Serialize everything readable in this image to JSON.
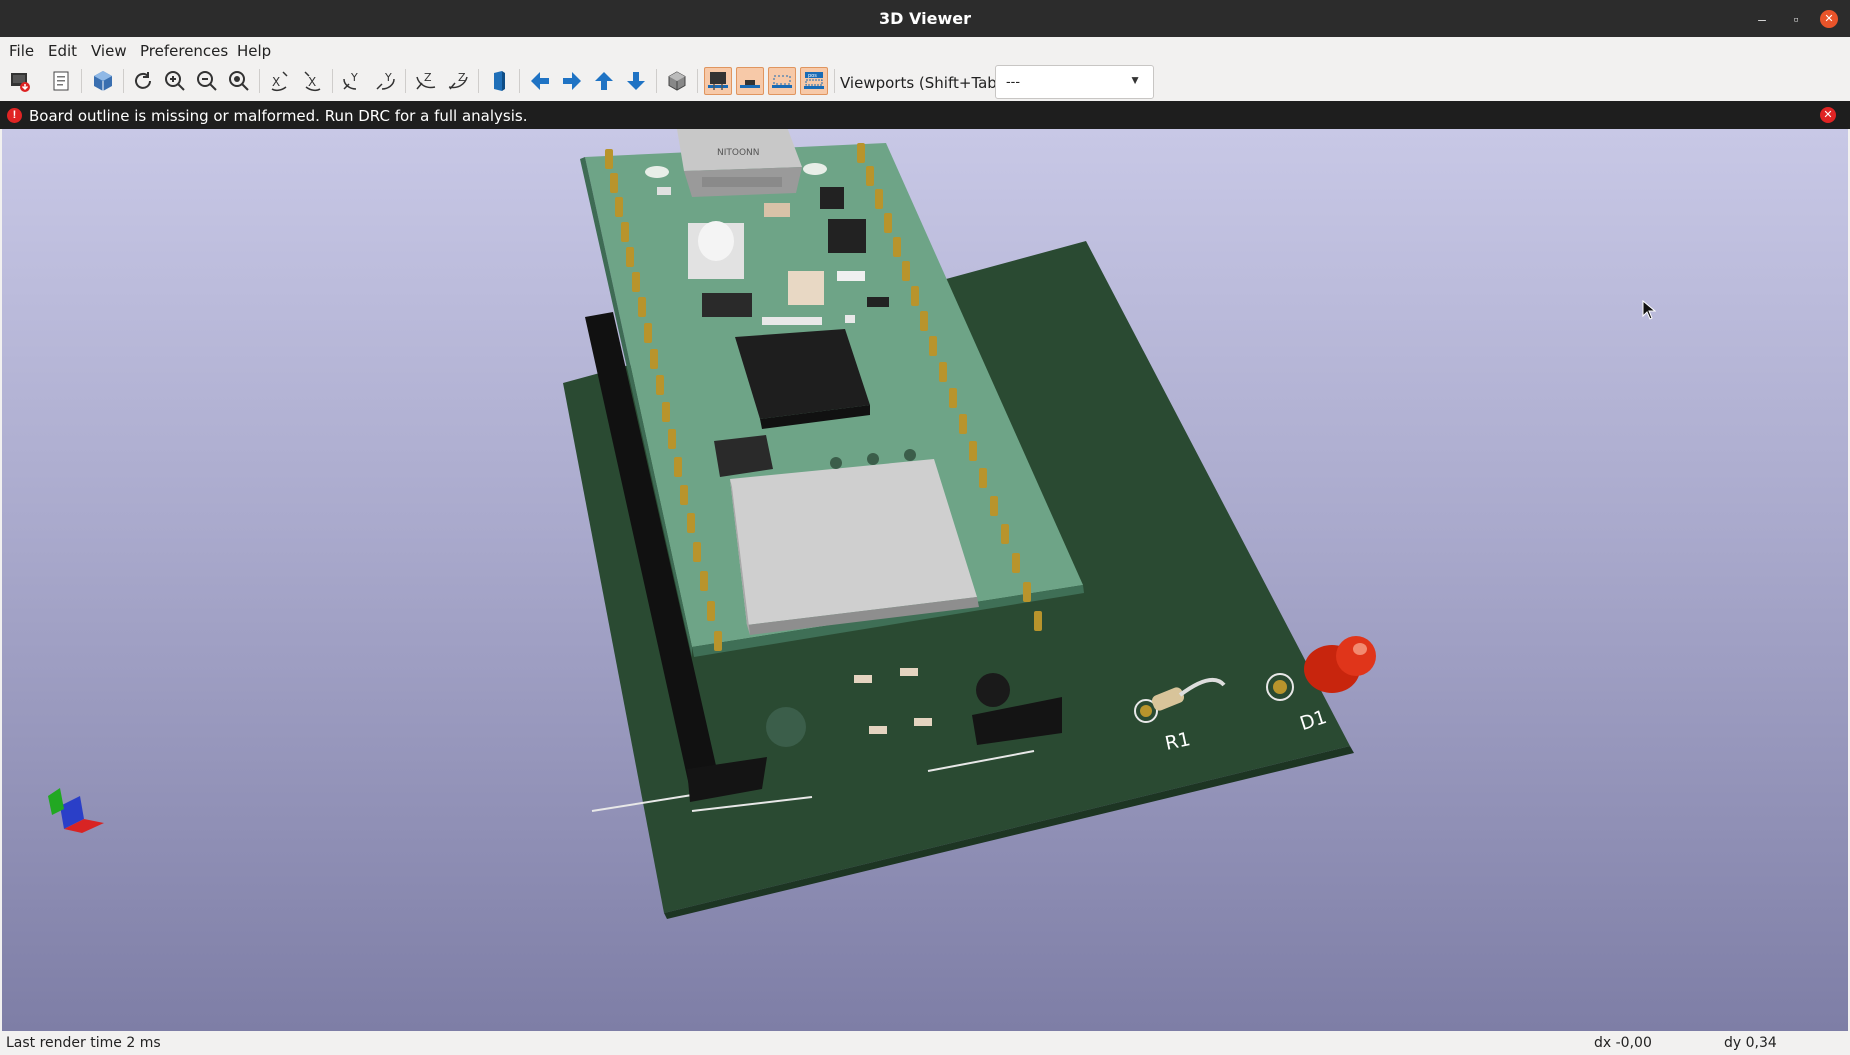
{
  "window": {
    "title": "3D Viewer",
    "minimize_symbol": "–",
    "maximize_symbol": "▫",
    "close_symbol": "✕"
  },
  "menubar": {
    "items": [
      "File",
      "Edit",
      "View",
      "Preferences",
      "Help"
    ]
  },
  "toolbar": {
    "icons": [
      "export-image-icon",
      "copy-clipboard-icon",
      "raytrace-icon",
      "reload-icon",
      "zoom-in-icon",
      "zoom-out-icon",
      "zoom-fit-icon",
      "rotate-x-cw-icon",
      "rotate-x-ccw-icon",
      "rotate-y-cw-icon",
      "rotate-y-ccw-icon",
      "rotate-z-cw-icon",
      "rotate-z-ccw-icon",
      "flip-board-icon",
      "pan-left-icon",
      "pan-right-icon",
      "pan-up-icon",
      "pan-down-icon",
      "ortho-toggle-icon",
      "show-tht-icon",
      "show-smd-icon",
      "show-virtual-icon",
      "show-not-in-pos-icon"
    ],
    "viewports_label": "Viewports (Shift+Tab):",
    "viewports_value": "---"
  },
  "infobar": {
    "message": "Board outline is missing or malformed. Run DRC for a full analysis.",
    "icon_symbol": "!",
    "close_symbol": "✕"
  },
  "viewport": {
    "silkscreen": {
      "r1": "R1",
      "d1": "D1",
      "connector_text": "NITOONN"
    },
    "colors": {
      "background_top": "#c8c8e6",
      "background_bottom": "#7e7ea6",
      "main_board": "#2a4a32",
      "module_board": "#6ea487",
      "pin_gold": "#b8942c",
      "led_red": "#d32a10"
    }
  },
  "statusbar": {
    "render_time": "Last render time 2 ms",
    "dx": "dx -0,00",
    "dy": "dy 0,34"
  }
}
